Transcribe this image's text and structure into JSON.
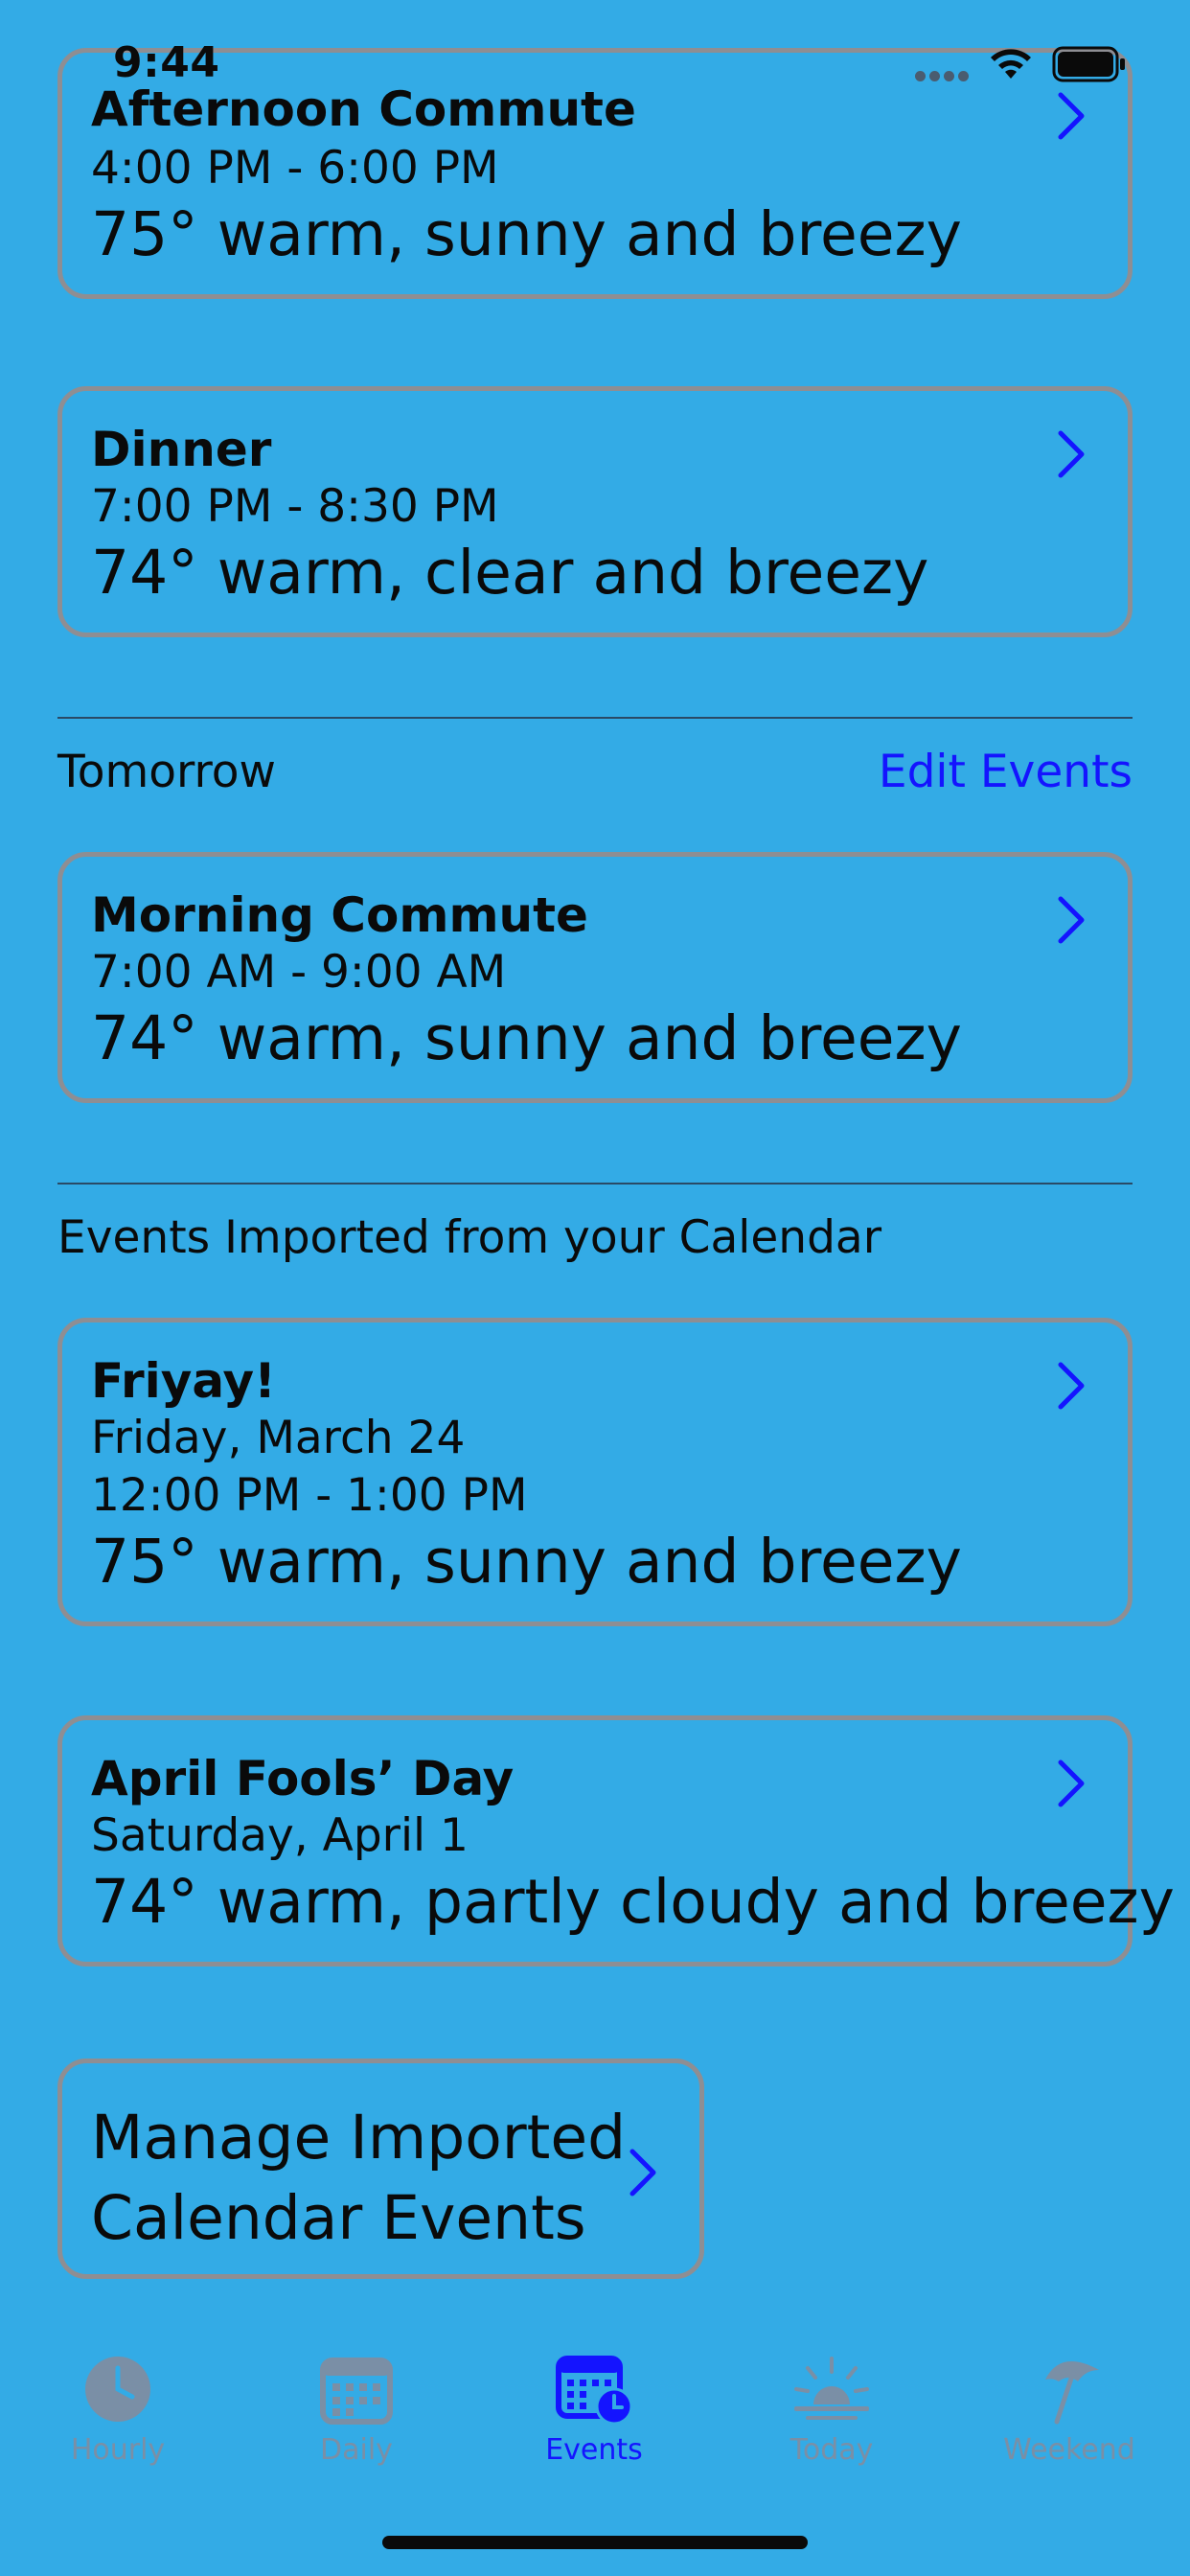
{
  "status_bar": {
    "time": "9:44"
  },
  "today_events": [
    {
      "title": "Afternoon Commute",
      "time_range": "4:00 PM  -  6:00 PM",
      "forecast": "75° warm, sunny and breezy"
    },
    {
      "title": "Dinner",
      "time_range": "7:00 PM  -  8:30 PM",
      "forecast": "74° warm, clear and breezy"
    }
  ],
  "tomorrow": {
    "label": "Tomorrow",
    "edit_label": "Edit Events",
    "events": [
      {
        "title": "Morning Commute",
        "time_range": "7:00 AM  -  9:00 AM",
        "forecast": "74° warm, sunny and breezy"
      }
    ]
  },
  "imported": {
    "label": "Events Imported from your Calendar",
    "events": [
      {
        "title": "Friyay!",
        "date": "Friday, March 24",
        "time_range": "12:00 PM  -  1:00 PM",
        "forecast": "75° warm, sunny and breezy"
      },
      {
        "title": "April Fools’ Day",
        "date": "Saturday, April 1",
        "forecast": "74° warm, partly cloudy and breezy"
      }
    ],
    "manage_label": "Manage Imported Calendar Events"
  },
  "tab_bar": {
    "tabs": [
      {
        "label": "Hourly",
        "icon": "clock-icon",
        "active": false
      },
      {
        "label": "Daily",
        "icon": "calendar-icon",
        "active": false
      },
      {
        "label": "Events",
        "icon": "calendar-clock-icon",
        "active": true
      },
      {
        "label": "Today",
        "icon": "sunrise-icon",
        "active": false
      },
      {
        "label": "Weekend",
        "icon": "beach-umbrella-icon",
        "active": false
      }
    ]
  },
  "colors": {
    "background": "#33ABE6",
    "accent": "#1414FF",
    "card_border": "#8E8E93",
    "inactive_tab": "#7A8FA6"
  }
}
